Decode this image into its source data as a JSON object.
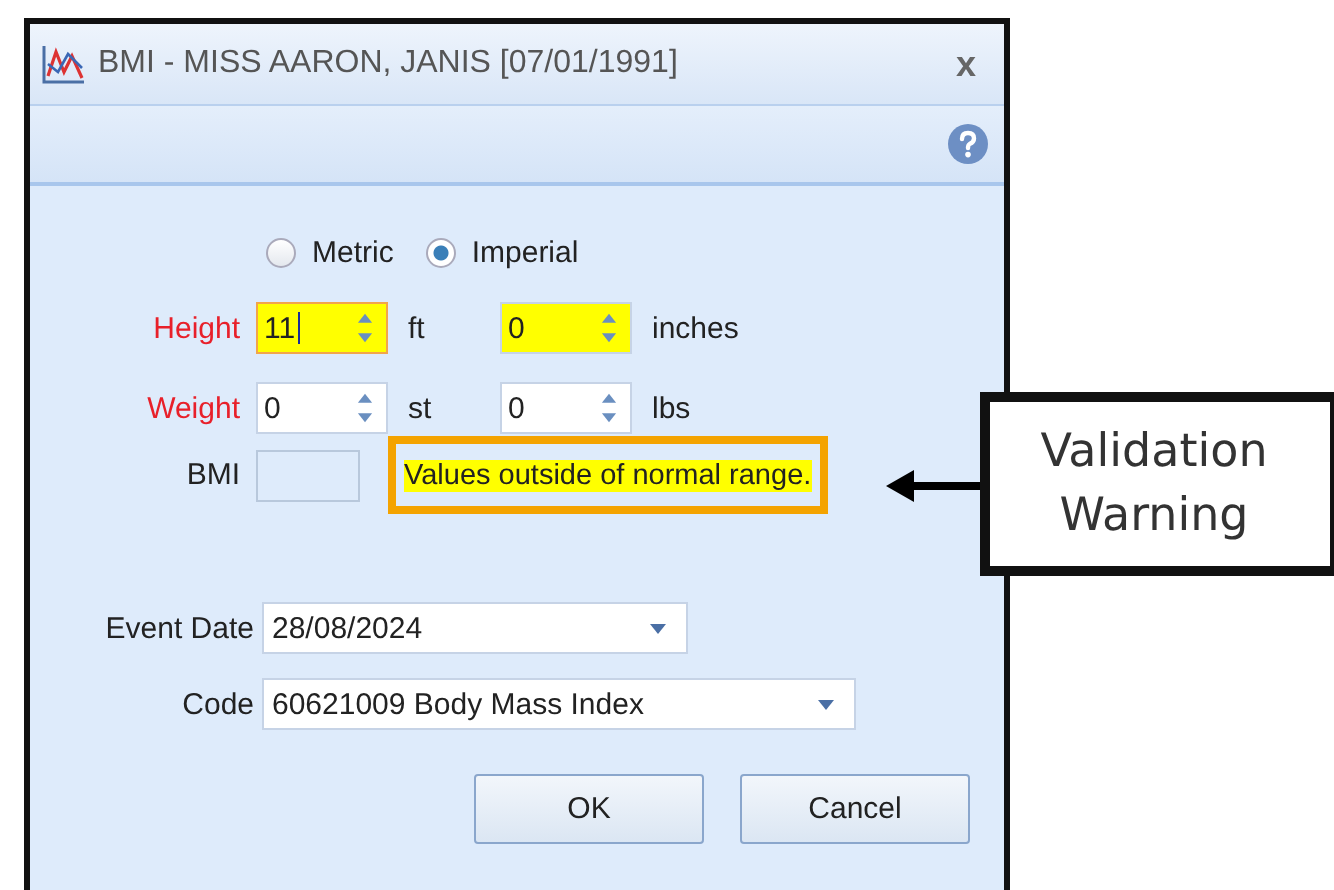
{
  "window": {
    "title": "BMI - MISS AARON, JANIS [07/01/1991]",
    "close": "x"
  },
  "units": [
    {
      "label": "Metric",
      "selected": false
    },
    {
      "label": "Imperial",
      "selected": true
    }
  ],
  "measurements": [
    {
      "label": "Height",
      "invalid": true,
      "inputs": [
        {
          "value": "11",
          "unit": "ft",
          "highlighted": true,
          "focused": true
        },
        {
          "value": "0",
          "unit": "inches",
          "highlighted": true,
          "focused": false
        }
      ]
    },
    {
      "label": "Weight",
      "invalid": true,
      "inputs": [
        {
          "value": "0",
          "unit": "st",
          "highlighted": false,
          "focused": false
        },
        {
          "value": "0",
          "unit": "lbs",
          "highlighted": false,
          "focused": false
        }
      ]
    }
  ],
  "bmi": {
    "label": "BMI"
  },
  "warning": {
    "text": "Values outside of normal range."
  },
  "event_date": {
    "label": "Event Date",
    "value": "28/08/2024"
  },
  "code": {
    "label": "Code",
    "value": "60621009 Body Mass Index"
  },
  "buttons": [
    "OK",
    "Cancel"
  ],
  "callout": {
    "text": "Validation Warning"
  }
}
